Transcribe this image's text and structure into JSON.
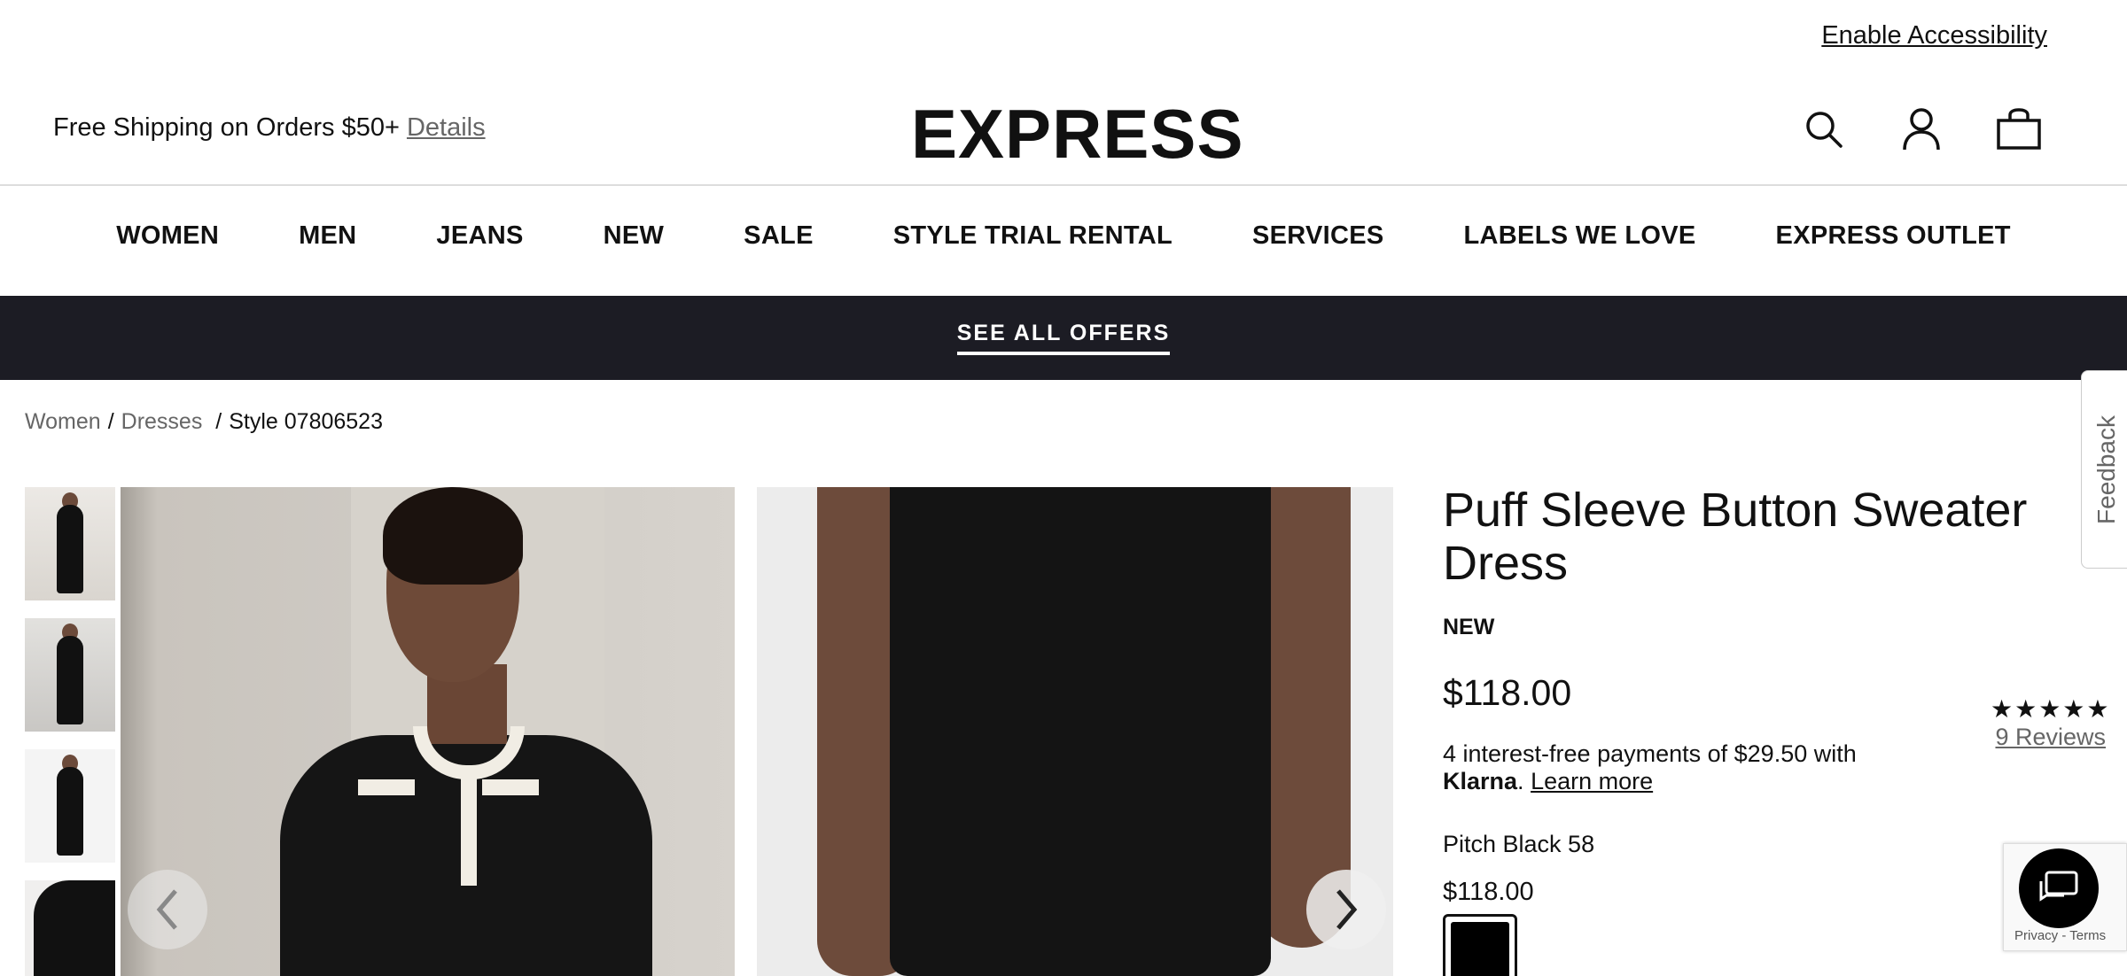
{
  "utility": {
    "accessibility_link": "Enable Accessibility"
  },
  "promo": {
    "text": "Free Shipping on Orders $50+",
    "details_link": "Details"
  },
  "brand": {
    "logo": "EXPRESS"
  },
  "header_icons": [
    "search-icon",
    "account-icon",
    "bag-icon"
  ],
  "nav": {
    "items": [
      {
        "label": "WOMEN"
      },
      {
        "label": "MEN"
      },
      {
        "label": "JEANS"
      },
      {
        "label": "NEW"
      },
      {
        "label": "SALE"
      },
      {
        "label": "STYLE TRIAL RENTAL"
      },
      {
        "label": "SERVICES"
      },
      {
        "label": "LABELS WE LOVE"
      },
      {
        "label": "EXPRESS OUTLET"
      }
    ]
  },
  "offers_banner": {
    "label": "SEE ALL OFFERS",
    "bg": "#1c1c24"
  },
  "breadcrumb": {
    "items": [
      "Women",
      "Dresses"
    ],
    "current": "Style 07806523"
  },
  "product": {
    "title": "Puff Sleeve Button Sweater Dress",
    "badge": "NEW",
    "price": "$118.00",
    "klarna_text": "4 interest-free payments of $29.50 with",
    "klarna_brand": "Klarna",
    "klarna_link": "Learn more",
    "color_name": "Pitch Black 58",
    "color_price": "$118.00",
    "swatch_color": "#000000"
  },
  "rating": {
    "stars": "★★★★★",
    "reviews": "9 Reviews"
  },
  "feedback_tab": {
    "label": "Feedback"
  },
  "recaptcha": {
    "terms": "Privacy - Terms"
  }
}
